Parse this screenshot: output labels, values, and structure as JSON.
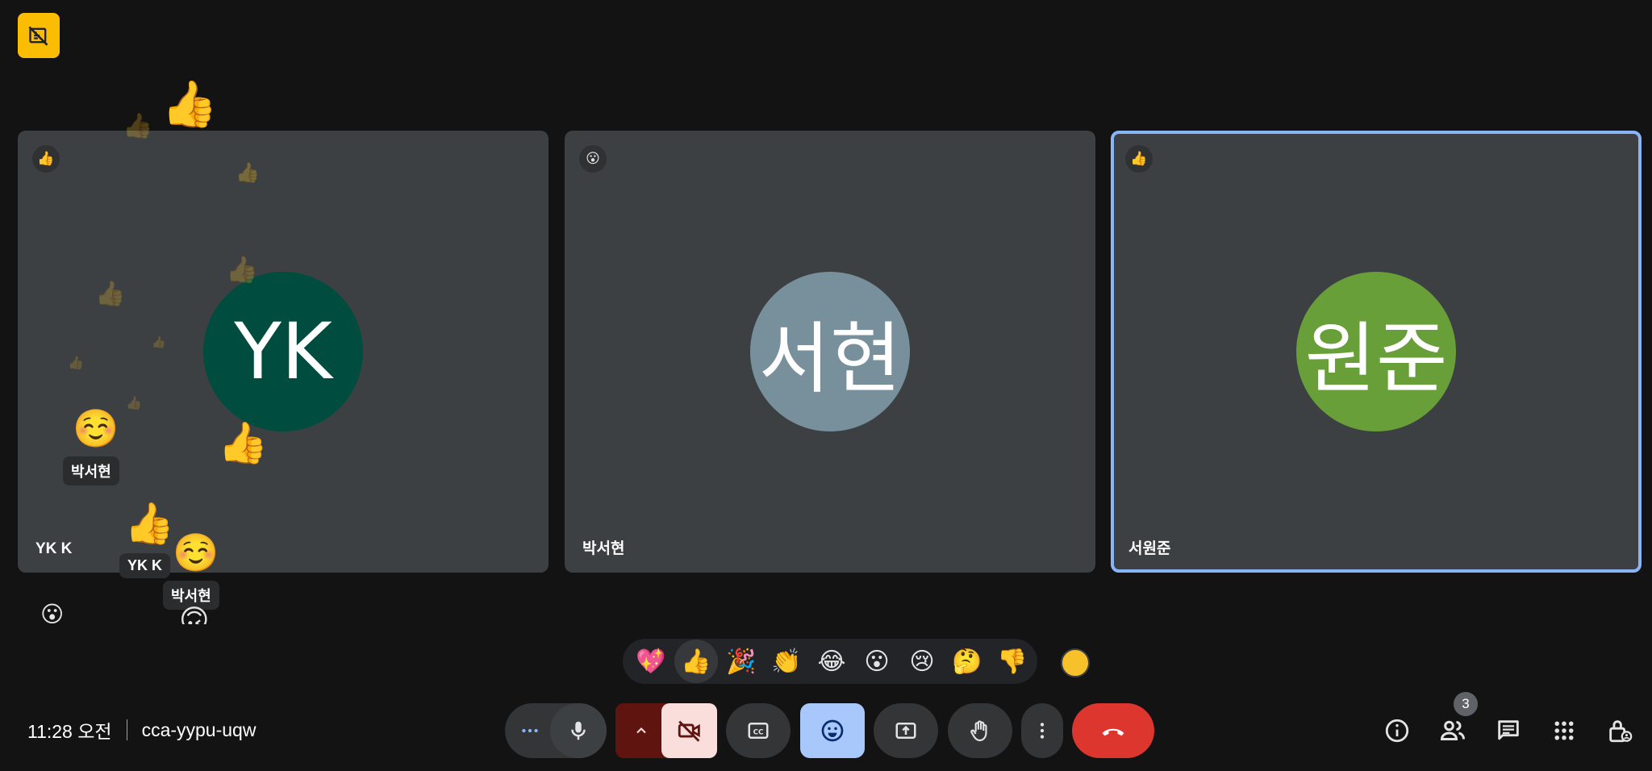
{
  "meeting": {
    "time": "11:28 오전",
    "code": "cca-yypu-uqw",
    "participant_count": "3"
  },
  "tiles": [
    {
      "name": "YK K",
      "initials": "YK",
      "avatar_color": "#004d40",
      "reaction": "👍",
      "active": false
    },
    {
      "name": "박서현",
      "initials": "서현",
      "avatar_color": "#78909c",
      "reaction": "😮",
      "active": false
    },
    {
      "name": "서원준",
      "initials": "원준",
      "avatar_color": "#689f38",
      "reaction": "👍",
      "active": true
    }
  ],
  "floating_reactions": [
    {
      "emoji": "👍",
      "label": ""
    },
    {
      "emoji": "☺️",
      "label": "박서현"
    },
    {
      "emoji": "👍",
      "label": ""
    },
    {
      "emoji": "👍",
      "label": "YK K"
    },
    {
      "emoji": "☺️",
      "label": "박서현"
    },
    {
      "emoji": "😮",
      "label": ""
    },
    {
      "emoji": "🙃",
      "label": ""
    }
  ],
  "reaction_bar": [
    "💖",
    "👍",
    "🎉",
    "👏",
    "😂",
    "😮",
    "😢",
    "🤔",
    "👎"
  ],
  "reaction_bar_selected": "👍",
  "colors": {
    "background": "#131314",
    "tile": "#3c4043",
    "active_border": "#8ab4f8",
    "end_call": "#dc362e",
    "reactions_active": "#a8c7fa",
    "camera_off": "#f9dedc",
    "camera_chevron": "#601410",
    "badge": "#fbbc04"
  },
  "icons": {
    "top_badge": "no-video-recording-icon",
    "more_options": "more-horiz-icon",
    "microphone": "mic-icon",
    "chevron": "chevron-up-icon",
    "camera_off": "videocam-off-icon",
    "captions": "closed-caption-icon",
    "reactions": "emoji-icon",
    "present": "present-screen-icon",
    "raise_hand": "raise-hand-icon",
    "more_vert": "more-vert-icon",
    "end_call": "call-end-icon",
    "info": "info-icon",
    "people": "people-icon",
    "chat": "chat-icon",
    "activities": "apps-icon",
    "host_controls": "lock-person-icon"
  }
}
